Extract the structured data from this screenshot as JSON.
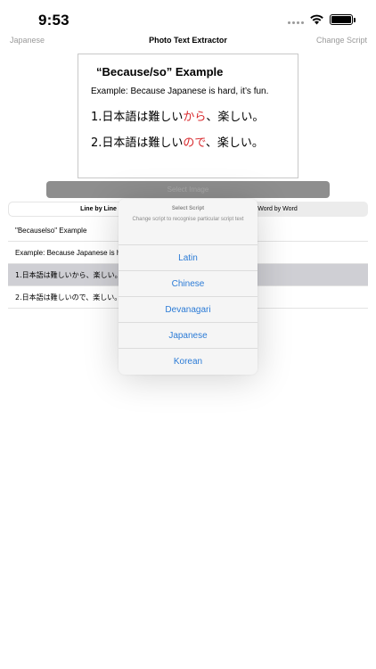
{
  "status_bar": {
    "time": "9:53"
  },
  "nav": {
    "left_label": "Japanese",
    "title": "Photo Text Extractor",
    "right_label": "Change Script"
  },
  "image_preview": {
    "title": "“Because/so” Example",
    "example_line": "Example: Because Japanese is hard, it’s fun.",
    "line1_prefix": "1.日本語は難しい",
    "line1_highlight": "から",
    "line1_suffix": "、楽しい。",
    "line2_prefix": "2.日本語は難しい",
    "line2_highlight": "ので",
    "line2_suffix": "、楽しい。",
    "highlight_color": "#d8282c"
  },
  "select_image_button": "Select Image",
  "segments": {
    "line_by_line": "Line by Line",
    "word_by_word": "Word by Word"
  },
  "results": [
    "\"Becauselso\" Example",
    "Example: Because Japanese is hard, it's fun.",
    "1.日本語は難しいから、楽しい。",
    "2.日本語は難しいので、楽しい。"
  ],
  "popover": {
    "title": "Select Script",
    "message": "Change script to recognise particular script text",
    "options": [
      "Latin",
      "Chinese",
      "Devanagari",
      "Japanese",
      "Korean"
    ],
    "accent_color": "#2b7bd6"
  }
}
